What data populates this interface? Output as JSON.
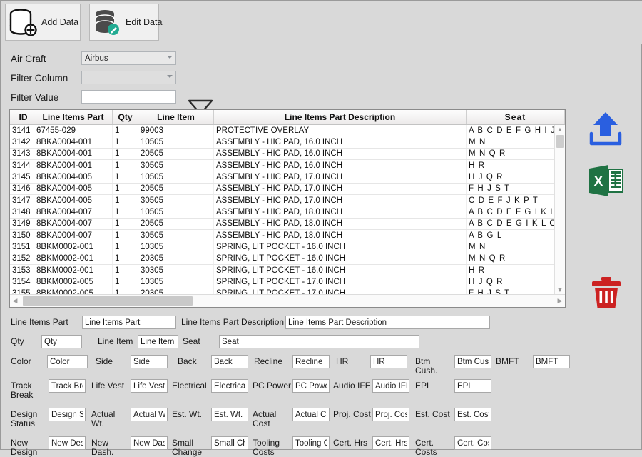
{
  "toolbar": {
    "add_data_label": "Add Data",
    "add_data_icon": "database-add-icon",
    "edit_data_label": "Edit Data",
    "edit_data_icon": "database-edit-icon"
  },
  "filters": {
    "aircraft_label": "Air Craft",
    "aircraft_value": "Airbus",
    "aircraft_options": [
      "Airbus"
    ],
    "filter_column_label": "Filter Column",
    "filter_column_value": "",
    "filter_value_label": "Filter Value",
    "filter_value": "",
    "funnel_icon": "funnel-filter-icon"
  },
  "grid": {
    "columns": [
      "ID",
      "Line Items Part",
      "Qty",
      "Line Item",
      "Line Items Part Description",
      "Seat"
    ],
    "rows": [
      [
        "3141",
        "67455-029",
        "1",
        "99003",
        "PROTECTIVE OVERLAY",
        "A B C D E F G H I J K L M N"
      ],
      [
        "3142",
        "8BKA0004-001",
        "1",
        "10505",
        "ASSEMBLY - HIC PAD, 16.0 INCH",
        "M N"
      ],
      [
        "3143",
        "8BKA0004-001",
        "1",
        "20505",
        "ASSEMBLY - HIC PAD, 16.0 INCH",
        "M N Q R"
      ],
      [
        "3144",
        "8BKA0004-001",
        "1",
        "30505",
        "ASSEMBLY - HIC PAD, 16.0 INCH",
        "H R"
      ],
      [
        "3145",
        "8BKA0004-005",
        "1",
        "10505",
        "ASSEMBLY - HIC PAD, 17.0 INCH",
        "H J Q R"
      ],
      [
        "3146",
        "8BKA0004-005",
        "1",
        "20505",
        "ASSEMBLY - HIC PAD, 17.0 INCH",
        "F H J S T"
      ],
      [
        "3147",
        "8BKA0004-005",
        "1",
        "30505",
        "ASSEMBLY - HIC PAD, 17.0 INCH",
        "C D E F J K P T"
      ],
      [
        "3148",
        "8BKA0004-007",
        "1",
        "10505",
        "ASSEMBLY - HIC PAD, 18.0 INCH",
        "A B C D E F G I K L O P S T"
      ],
      [
        "3149",
        "8BKA0004-007",
        "1",
        "20505",
        "ASSEMBLY - HIC PAD, 18.0 INCH",
        "A B C D E G I K L O P"
      ],
      [
        "3150",
        "8BKA0004-007",
        "1",
        "30505",
        "ASSEMBLY - HIC PAD, 18.0 INCH",
        "A B G L"
      ],
      [
        "3151",
        "8BKM0002-001",
        "1",
        "10305",
        "SPRING, LIT POCKET - 16.0 INCH",
        "M N"
      ],
      [
        "3152",
        "8BKM0002-001",
        "1",
        "20305",
        "SPRING, LIT POCKET - 16.0 INCH",
        "M N Q R"
      ],
      [
        "3153",
        "8BKM0002-001",
        "1",
        "30305",
        "SPRING, LIT POCKET - 16.0 INCH",
        "H R"
      ],
      [
        "3154",
        "8BKM0002-005",
        "1",
        "10305",
        "SPRING, LIT POCKET - 17.0 INCH",
        "H J Q R"
      ],
      [
        "3155",
        "8BKM0002-005",
        "1",
        "20305",
        "SPRING, LIT POCKET - 17.0 INCH",
        "F H J S T"
      ]
    ]
  },
  "rail": {
    "upload_icon": "upload-arrow-icon",
    "excel_icon": "excel-export-icon",
    "delete_icon": "trash-delete-icon"
  },
  "form": {
    "fields": [
      {
        "label": "Line Items Part",
        "placeholder": "Line Items Part"
      },
      {
        "label": "Line Items Part Description",
        "placeholder": "Line Items Part Description"
      },
      {
        "label": "Qty",
        "placeholder": "Qty"
      },
      {
        "label": "Line Item",
        "placeholder": "Line Item"
      },
      {
        "label": "Seat",
        "placeholder": "Seat"
      },
      {
        "label": "Color",
        "placeholder": "Color"
      },
      {
        "label": "Side",
        "placeholder": "Side"
      },
      {
        "label": "Back",
        "placeholder": "Back"
      },
      {
        "label": "Recline",
        "placeholder": "Recline"
      },
      {
        "label": "HR",
        "placeholder": "HR"
      },
      {
        "label": "Btm\nCush.",
        "placeholder": "Btm Cush."
      },
      {
        "label": "BMFT",
        "placeholder": "BMFT"
      },
      {
        "label": "Track\nBreak",
        "placeholder": "Track Break"
      },
      {
        "label": "Life Vest",
        "placeholder": "Life Vest"
      },
      {
        "label": "Electrical",
        "placeholder": "Electrical"
      },
      {
        "label": "PC Power",
        "placeholder": "PC Power"
      },
      {
        "label": "Audio IFE",
        "placeholder": "Audio IFE"
      },
      {
        "label": "EPL",
        "placeholder": "EPL"
      },
      {
        "label": "Design\nStatus",
        "placeholder": "Design Status"
      },
      {
        "label": "Actual\nWt.",
        "placeholder": "Actual Wt."
      },
      {
        "label": "Est. Wt.",
        "placeholder": "Est. Wt."
      },
      {
        "label": "Actual\nCost",
        "placeholder": "Actual Cost"
      },
      {
        "label": "Proj. Cost",
        "placeholder": "Proj. Cost"
      },
      {
        "label": "Est. Cost",
        "placeholder": "Est. Cost"
      },
      {
        "label": "New\nDesign",
        "placeholder": "New Design"
      },
      {
        "label": "New\nDash.",
        "placeholder": "New Dash."
      },
      {
        "label": "Small\nChange",
        "placeholder": "Small Change"
      },
      {
        "label": "Tooling\nCosts",
        "placeholder": "Tooling Costs"
      },
      {
        "label": "Cert. Hrs",
        "placeholder": "Cert. Hrs"
      },
      {
        "label": "Cert.\nCosts",
        "placeholder": "Cert. Costs"
      }
    ]
  },
  "colors": {
    "window_background": "#d9d9d9",
    "upload_blue": "#2a5fe0",
    "excel_green": "#1f7243",
    "delete_red": "#cc2222",
    "edit_badge_teal": "#22ab92"
  }
}
